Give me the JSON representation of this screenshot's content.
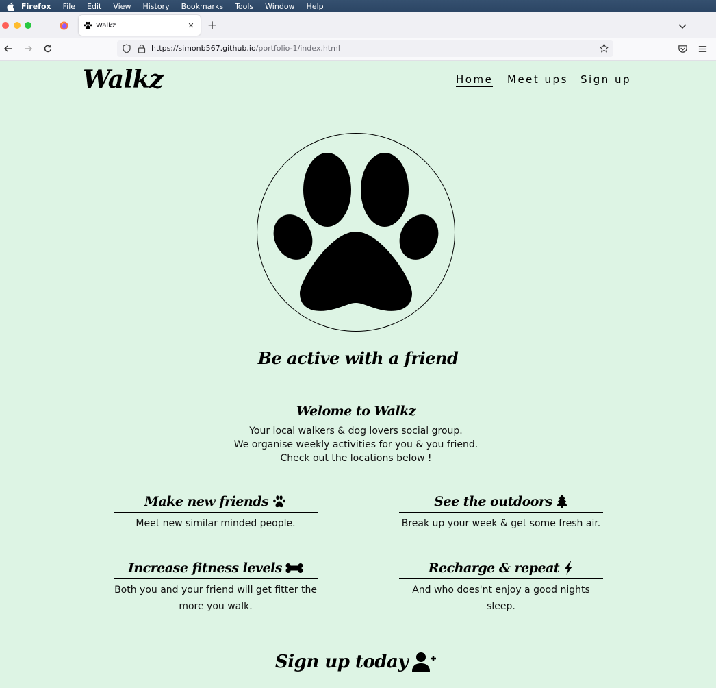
{
  "menubar": {
    "app": "Firefox",
    "items": [
      "File",
      "Edit",
      "View",
      "History",
      "Bookmarks",
      "Tools",
      "Window",
      "Help"
    ]
  },
  "browser": {
    "tab_title": "Walkz",
    "url_host": "https://simonb567.github.io",
    "url_path": "/portfolio-1/index.html"
  },
  "site": {
    "logo": "Walkz",
    "nav": {
      "home": "Home",
      "meetups": "Meet ups",
      "signup": "Sign up"
    },
    "tagline": "Be active with a friend",
    "welcome": {
      "title": "Welome to Walkz",
      "lines": [
        "Your local walkers & dog lovers social group.",
        "We organise weekly activities for you & you friend.",
        "Check out the locations below !"
      ]
    },
    "features": [
      {
        "title": "Make new friends",
        "icon": "paw-icon",
        "desc": "Meet new similar minded people."
      },
      {
        "title": "See the outdoors",
        "icon": "tree-icon",
        "desc": "Break up your week & get some fresh air."
      },
      {
        "title": "Increase fitness levels",
        "icon": "bone-icon",
        "desc": "Both you and your friend will get fitter the more you walk."
      },
      {
        "title": "Recharge & repeat",
        "icon": "bolt-icon",
        "desc": "And who does'nt enjoy a good nights sleep."
      }
    ],
    "cta": "Sign up today",
    "colors": {
      "background": "#ddf4e4",
      "text": "#000000"
    }
  }
}
